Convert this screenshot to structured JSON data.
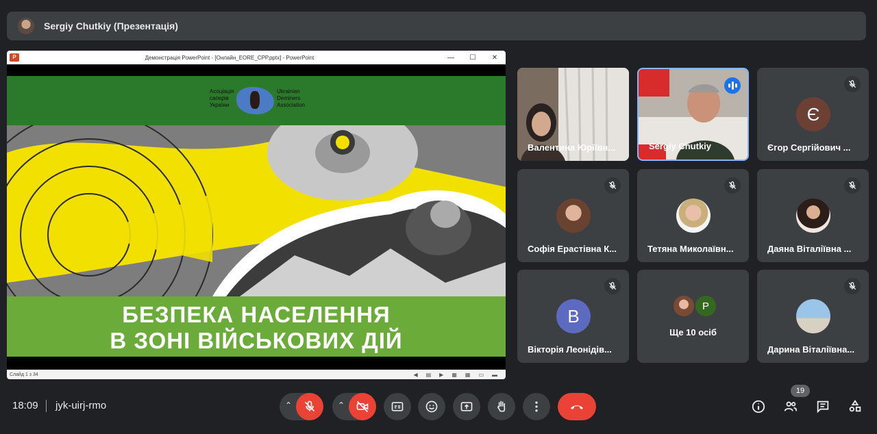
{
  "header": {
    "presenter_title": "Sergiy Chutkiy (Презентація)"
  },
  "presentation": {
    "window_title": "Демонстрація PowerPoint - [Онлайн_EORE_СРР.pptx] - PowerPoint",
    "app_icon": "P",
    "window_controls": [
      "—",
      "☐",
      "✕"
    ],
    "assoc_uk": [
      "Асоціація",
      "саперів",
      "України"
    ],
    "assoc_en": [
      "Ukrainian",
      "Deminers",
      "Association"
    ],
    "headline_line1": "БЕЗПЕКА НАСЕЛЕННЯ",
    "headline_line2": "В ЗОНІ ВІЙСЬКОВИХ ДІЙ",
    "slide_counter": "Слайд 1 з 34"
  },
  "participants": [
    {
      "name": "Валентина Юріївн...",
      "type": "video"
    },
    {
      "name": "Sergiy Chutkiy",
      "type": "video",
      "speaking": true
    },
    {
      "name": "Єгор Сергійович ...",
      "initial": "Є",
      "color": "#6d4034",
      "muted": true
    },
    {
      "name": "Софія Ерастівна К...",
      "type": "photo",
      "muted": true
    },
    {
      "name": "Тетяна Миколаївн...",
      "type": "photo",
      "muted": true
    },
    {
      "name": "Даяна Віталіївна ...",
      "type": "photo",
      "muted": true
    },
    {
      "name": "Вікторія Леонідів...",
      "initial": "В",
      "color": "#5c6bc0",
      "muted": true
    },
    {
      "name": "Ще 10 осіб",
      "initial": "P",
      "color": "#33691e"
    },
    {
      "name": "Дарина Віталіївна...",
      "type": "photo",
      "muted": true
    }
  ],
  "meeting": {
    "time": "18:09",
    "code": "jyk-uirj-rmo",
    "participant_count": "19"
  },
  "colors": {
    "background": "#202124",
    "tile": "#3c4043",
    "red": "#ea4335",
    "accent": "#8ab4f8"
  }
}
